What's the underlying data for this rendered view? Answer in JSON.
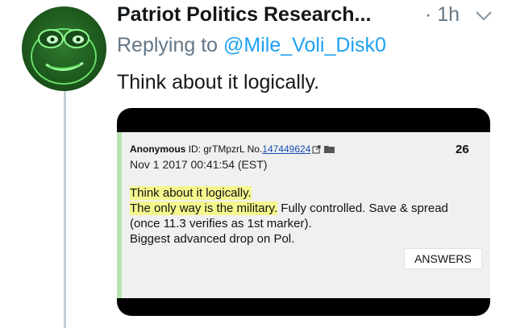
{
  "tweet": {
    "author_name": "Patriot Politics Research...",
    "time": "· 1h",
    "reply_prefix": "Replying to",
    "reply_handle": "@Mile_Voli_Disk0",
    "text": "Think about it logically."
  },
  "post": {
    "name": "Anonymous",
    "id_label": "ID: grTMpzrL",
    "no_label": "No.",
    "post_number": "147449624",
    "reply_count": "26",
    "date": "Nov 1 2017 00:41:54 (EST)",
    "line1": "Think about it logically.",
    "line2_highlight": "The only way is the military.",
    "line2_rest": " Fully controlled. Save & spread",
    "line3": "(once 11.3 verifies as 1st marker).",
    "line4": "Biggest advanced drop on Pol.",
    "answers_label": "ANSWERS"
  },
  "colors": {
    "handle": "#1da1f2",
    "secondary_text": "#657786",
    "highlight": "#f5f78e",
    "post_border": "#b8e3b0"
  }
}
